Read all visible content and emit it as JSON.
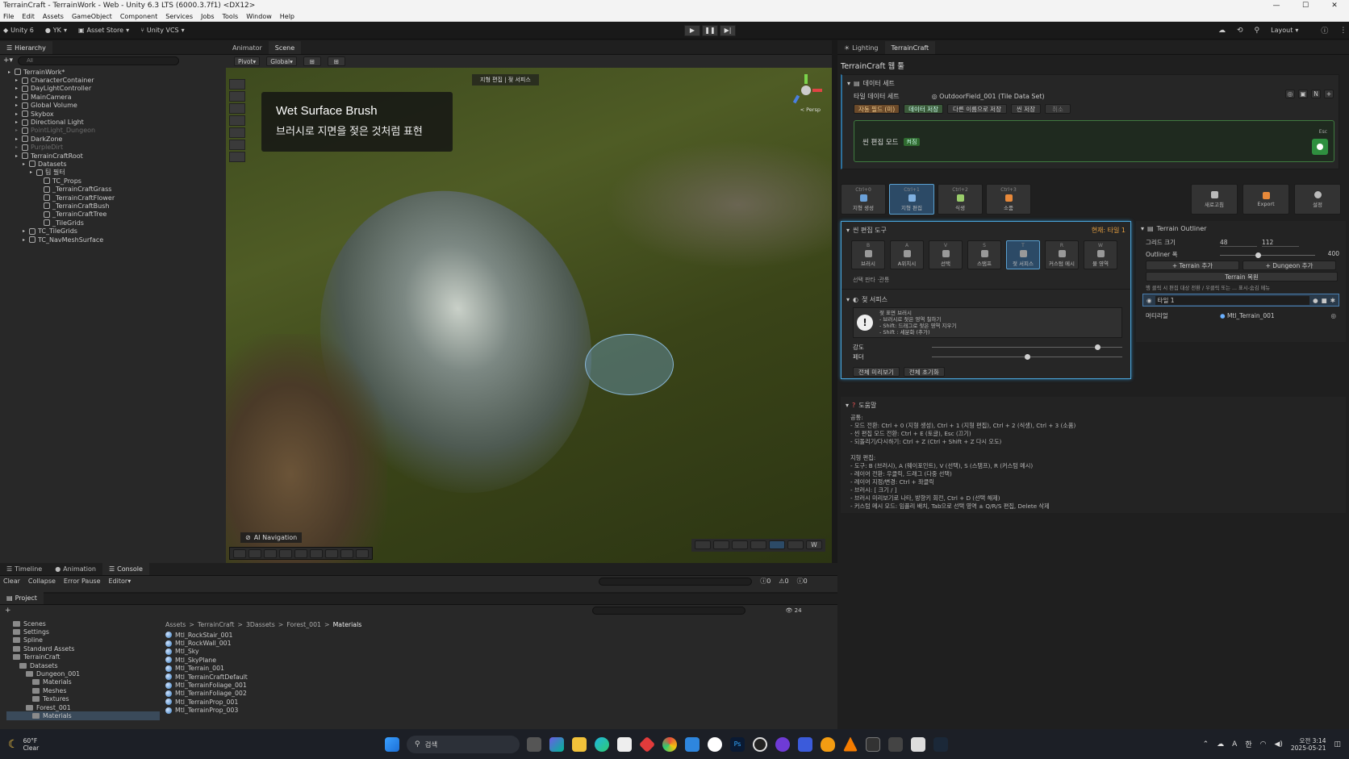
{
  "window": {
    "title": "TerrainCraft - TerrainWork - Web - Unity 6.3 LTS (6000.3.7f1) <DX12>"
  },
  "menu": [
    "File",
    "Edit",
    "Assets",
    "GameObject",
    "Component",
    "Services",
    "Jobs",
    "Tools",
    "Window",
    "Help"
  ],
  "toolbar": {
    "unity": "Unity 6",
    "account": "YK",
    "asset_store": "Asset Store",
    "vcs": "Unity VCS",
    "layout": "Layout"
  },
  "hierarchy": {
    "tab": "Hierarchy",
    "search_placeholder": "All",
    "items": [
      {
        "label": "TerrainWork*",
        "depth": 0,
        "dim": false
      },
      {
        "label": "CharacterContainer",
        "depth": 1,
        "dim": false
      },
      {
        "label": "DayLightController",
        "depth": 1,
        "dim": false
      },
      {
        "label": "MainCamera",
        "depth": 1,
        "dim": false
      },
      {
        "label": "Global Volume",
        "depth": 1,
        "dim": false
      },
      {
        "label": "Skybox",
        "depth": 1,
        "dim": false
      },
      {
        "label": "Directional Light",
        "depth": 1,
        "dim": false
      },
      {
        "label": "PointLight_Dungeon",
        "depth": 1,
        "dim": true
      },
      {
        "label": "DarkZone",
        "depth": 1,
        "dim": false
      },
      {
        "label": "PurpleDirt",
        "depth": 1,
        "dim": true
      },
      {
        "label": "TerrainCraftRoot",
        "depth": 1,
        "dim": false
      },
      {
        "label": "Datasets",
        "depth": 2,
        "dim": false
      },
      {
        "label": "팀 필터",
        "depth": 3,
        "dim": false
      },
      {
        "label": "TC_Props",
        "depth": 4,
        "dim": false
      },
      {
        "label": "_TerrainCraftGrass",
        "depth": 4,
        "dim": false
      },
      {
        "label": "_TerrainCraftFlower",
        "depth": 4,
        "dim": false
      },
      {
        "label": "_TerrainCraftBush",
        "depth": 4,
        "dim": false
      },
      {
        "label": "_TerrainCraftTree",
        "depth": 4,
        "dim": false
      },
      {
        "label": "_TileGrids",
        "depth": 4,
        "dim": false
      },
      {
        "label": "TC_TileGrids",
        "depth": 2,
        "dim": false
      },
      {
        "label": "TC_NavMeshSurface",
        "depth": 2,
        "dim": false
      }
    ]
  },
  "scene": {
    "tabs": [
      "Animator",
      "Scene"
    ],
    "pivot": "Pivot",
    "global": "Global",
    "overlay_title": "Wet Surface Brush",
    "overlay_subtitle": "브러시로 지면을 젖은 것처럼 표현",
    "ai_nav": "AI Navigation",
    "top_label": "지형 편집 | 젖 서피스",
    "persp": "< Persp"
  },
  "bottom": {
    "tabs": [
      "Timeline",
      "Animation",
      "Console"
    ],
    "console_buttons": [
      "Clear",
      "Collapse",
      "Error Pause",
      "Editor"
    ],
    "counts": [
      "0",
      "0",
      "0"
    ],
    "project_tab": "Project",
    "breadcrumb": [
      "Assets",
      "TerrainCraft",
      "3Dassets",
      "Forest_001",
      "Materials"
    ],
    "folders": [
      {
        "label": "Scenes",
        "depth": 1
      },
      {
        "label": "Settings",
        "depth": 1
      },
      {
        "label": "Spline",
        "depth": 1
      },
      {
        "label": "Standard Assets",
        "depth": 1
      },
      {
        "label": "TerrainCraft",
        "depth": 1
      },
      {
        "label": "Datasets",
        "depth": 2
      },
      {
        "label": "Dungeon_001",
        "depth": 3
      },
      {
        "label": "Materials",
        "depth": 4
      },
      {
        "label": "Meshes",
        "depth": 4
      },
      {
        "label": "Textures",
        "depth": 4
      },
      {
        "label": "Forest_001",
        "depth": 3
      },
      {
        "label": "Materials",
        "depth": 4
      }
    ],
    "files": [
      "Mtl_RockStair_001",
      "Mtl_RockWall_001",
      "Mtl_Sky",
      "Mtl_SkyPlane",
      "Mtl_Terrain_001",
      "Mtl_TerrainCraftDefault",
      "Mtl_TerrainFoliage_001",
      "Mtl_TerrainFoliage_002",
      "Mtl_TerrainProp_001",
      "Mtl_TerrainProp_003"
    ],
    "file_count": "24"
  },
  "inspector": {
    "tabs": [
      "Lighting",
      "TerrainCraft"
    ],
    "title": "TerrainCraft 웹 툴",
    "dataset_header": "데이터 세트",
    "dataset_label": "타일 데이터 세트",
    "dataset_value": "OutdoorField_001 (Tile Data Set)",
    "dataset_buttons": [
      "자동 필드 (미)",
      "데이터 저장",
      "다른 이름으로 저장",
      "씬 저장",
      "취소"
    ],
    "edit_mode": "씬 편집 모드",
    "edit_mode_badge": "켜짐",
    "esc": "Esc",
    "modes": [
      {
        "key": "Ctrl+0",
        "label": "지형 생성"
      },
      {
        "key": "Ctrl+1",
        "label": "지형 편집"
      },
      {
        "key": "Ctrl+2",
        "label": "식생"
      },
      {
        "key": "Ctrl+3",
        "label": "소품"
      }
    ],
    "right_modes": [
      "새로고침",
      "Export",
      "설정"
    ],
    "tool_header": "씬 편집 도구",
    "tool_current": "현재: 타일 1",
    "tools": [
      {
        "key": "B",
        "label": "브러시"
      },
      {
        "key": "A",
        "label": "A위치시"
      },
      {
        "key": "V",
        "label": "선택"
      },
      {
        "key": "S",
        "label": "스탬프"
      },
      {
        "key": "T",
        "label": "젖 서피스"
      },
      {
        "key": "R",
        "label": "커스텀 메시"
      },
      {
        "key": "W",
        "label": "물 영역"
      }
    ],
    "tool_hint": "선택 판타 ·관통",
    "wet_header": "젖 서피스",
    "wet_info": [
      "젖 표면 브러시",
      "- 브러시로 젖은 영역 칠하기",
      "- Shift: 드래그로 젖은 영역 지우기",
      "- Shift : 세분화 (추가)"
    ],
    "strength_label": "강도",
    "wetness_label": "페더",
    "strength": 0.87,
    "wetness": 0.5,
    "preview_btn": "전체 미리보기",
    "clear_btn": "전체 초기화",
    "help_header": "도움말",
    "help_lines": [
      "공통:",
      "- 모드 전환: Ctrl + 0 (지형 생성), Ctrl + 1 (지형 편집), Ctrl + 2 (식생), Ctrl + 3 (소품)",
      "- 씬 편집 모드 전환: Ctrl + E (토글), Esc (끄기)",
      "- 되돌리기/다시하기: Ctrl + Z (Ctrl + Shift + Z 다시 오도)",
      "",
      "지형 편집:",
      "- 도구: B (브러시), A (웨이포인트), V (선택), S (스탬프), R (커스텀 메시)",
      "- 레이어 전환: 우클릭, 드래그 (다중 선택)",
      "- 레이어 지정/변경: Ctrl + 좌클릭",
      "- 브러시: [ 크기 / ]",
      "- 브러시 미리보기로 나타, 방향키 회전, Ctrl + D (선택 해제)",
      "- 커스텀 메시 모드: 임플리 배치, Tab으로 선택 영역 ± Q/R/S 편집, Delete 삭제"
    ],
    "outliner": {
      "header": "Terrain Outliner",
      "grid_label": "그리드 크기",
      "grid_x": "48",
      "grid_y": "112",
      "width_label": "Outliner 폭",
      "width_value": "400",
      "width_ratio": 0.4,
      "add_terrain": "+ Terrain 추가",
      "add_dungeon": "+ Dungeon 추가",
      "restore": "Terrain 복원",
      "hint": "행 클릭 시 편집 대상 전환 / 우클릭 또는 ... 표시-숨김 메뉴",
      "tile_name": "타일 1",
      "material_label": "머티리얼",
      "material_value": "Mtl_Terrain_001"
    }
  },
  "taskbar": {
    "weather_temp": "60°F",
    "weather_desc": "Clear",
    "search": "검색",
    "time": "오전 3:14",
    "date": "2025-05-21"
  }
}
